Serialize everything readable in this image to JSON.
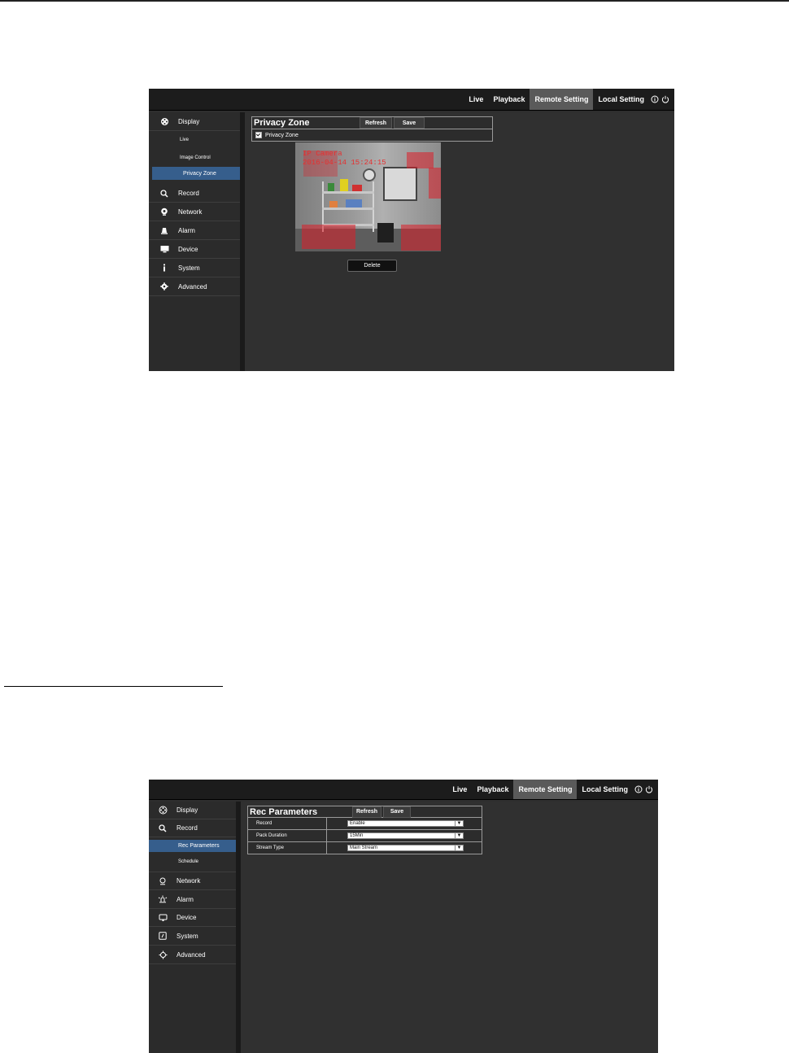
{
  "nav": {
    "items": [
      "Live",
      "Playback",
      "Remote Setting",
      "Local Setting"
    ],
    "active": "Remote Setting",
    "icons": [
      "info-icon",
      "power-icon"
    ]
  },
  "screen1": {
    "sidebar": {
      "display": "Display",
      "subitems": [
        "Live",
        "Image Control",
        "Privacy Zone"
      ],
      "active_sub": "Privacy Zone",
      "items": [
        "Record",
        "Network",
        "Alarm",
        "Device",
        "System",
        "Advanced"
      ]
    },
    "panel": {
      "title": "Privacy Zone",
      "refresh": "Refresh",
      "save": "Save",
      "checkbox_label": "Privacy Zone",
      "checkbox_checked": true
    },
    "camera": {
      "osd_name": "IP Camera",
      "osd_time": "2016-04-14 15:24:15"
    },
    "delete": "Delete",
    "mask_color": "#dc1e28"
  },
  "screen2": {
    "sidebar": {
      "items_top": [
        "Display",
        "Record"
      ],
      "subitems": [
        "Rec Parameters",
        "Schedule"
      ],
      "active_sub": "Rec Parameters",
      "items": [
        "Network",
        "Alarm",
        "Device",
        "System",
        "Advanced"
      ]
    },
    "panel": {
      "title": "Rec Parameters",
      "refresh": "Refresh",
      "save": "Save",
      "rows": [
        {
          "label": "Record",
          "value": "Enable"
        },
        {
          "label": "Pack Duration",
          "value": "15Min"
        },
        {
          "label": "Stream Type",
          "value": "Main Stream"
        }
      ]
    }
  },
  "colors": {
    "active_nav": "#5a5a5a",
    "active_sub": "#365e8c",
    "background": "#2e2e2e"
  }
}
